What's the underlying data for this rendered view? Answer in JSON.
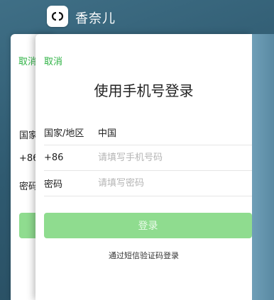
{
  "app": {
    "name": "香奈儿",
    "icon": "chanel-logo-icon"
  },
  "back_card": {
    "cancel_label": "取消",
    "country_label": "国家",
    "code_label": "+86",
    "password_label": "密码"
  },
  "form": {
    "cancel_label": "取消",
    "title": "使用手机号登录",
    "country": {
      "label": "国家/地区",
      "value": "中国"
    },
    "phone": {
      "label": "+86",
      "placeholder": "请填写手机号码"
    },
    "password": {
      "label": "密码",
      "placeholder": "请填写密码"
    },
    "login_label": "登录",
    "sms_login_label": "通过短信验证码登录"
  },
  "colors": {
    "accent": "#2fb345",
    "button": "#8fdc8f"
  }
}
